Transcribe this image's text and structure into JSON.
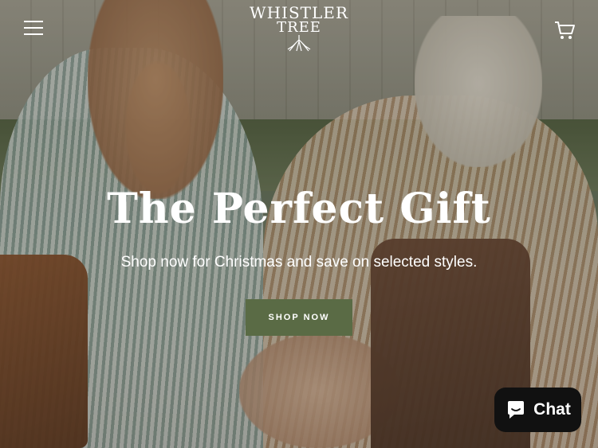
{
  "header": {
    "logo_line1": "WHISTLER",
    "logo_line2": "TREE",
    "menu_icon": "hamburger-menu-icon",
    "cart_icon": "shopping-cart-icon"
  },
  "hero": {
    "title": "The Perfect Gift",
    "subtitle": "Shop now for Christmas and save on selected styles.",
    "cta_label": "SHOP NOW"
  },
  "chat_widget": {
    "label": "Chat",
    "icon": "chat-bubble-icon",
    "background": "#111111"
  },
  "colors": {
    "accent": "#5a6b45",
    "text": "#ffffff"
  }
}
